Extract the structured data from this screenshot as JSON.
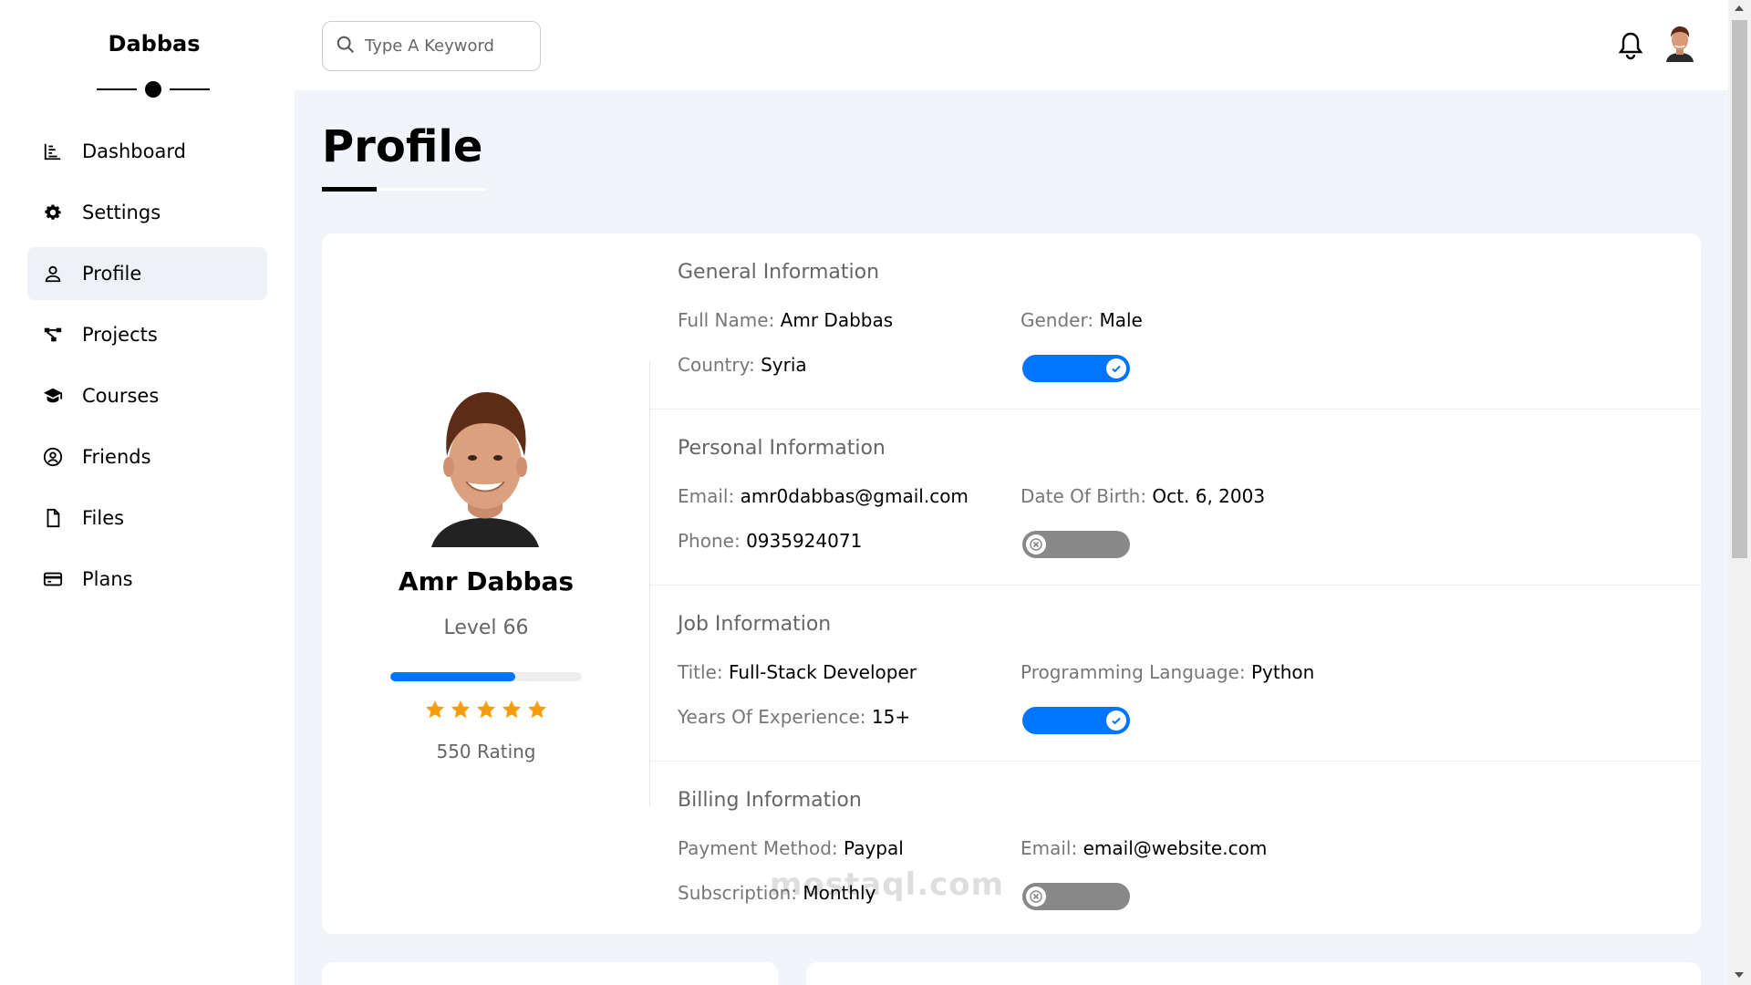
{
  "sidebar": {
    "brand": "Dabbas",
    "items": [
      {
        "label": "Dashboard",
        "icon": "chart-icon",
        "active": false
      },
      {
        "label": "Settings",
        "icon": "gear-icon",
        "active": false
      },
      {
        "label": "Profile",
        "icon": "user-icon",
        "active": true
      },
      {
        "label": "Projects",
        "icon": "diagram-icon",
        "active": false
      },
      {
        "label": "Courses",
        "icon": "graduation-cap-icon",
        "active": false
      },
      {
        "label": "Friends",
        "icon": "user-circle-icon",
        "active": false
      },
      {
        "label": "Files",
        "icon": "file-icon",
        "active": false
      },
      {
        "label": "Plans",
        "icon": "credit-card-icon",
        "active": false
      }
    ]
  },
  "header": {
    "search_placeholder": "Type A Keyword"
  },
  "page": {
    "title": "Profile"
  },
  "profile": {
    "name": "Amr Dabbas",
    "level": "Level 66",
    "progress_percent": 65,
    "stars": 5,
    "rating": "550 Rating"
  },
  "sections": [
    {
      "title": "General Information",
      "fields": [
        {
          "label": "Full Name:",
          "value": "Amr Dabbas"
        },
        {
          "label": "Country:",
          "value": "Syria"
        },
        {
          "label": "Gender:",
          "value": "Male"
        }
      ],
      "toggle_on": true
    },
    {
      "title": "Personal Information",
      "fields": [
        {
          "label": "Email:",
          "value": "amr0dabbas@gmail.com"
        },
        {
          "label": "Phone:",
          "value": "0935924071"
        },
        {
          "label": "Date Of Birth:",
          "value": "Oct. 6, 2003"
        }
      ],
      "toggle_on": false
    },
    {
      "title": "Job Information",
      "fields": [
        {
          "label": "Title:",
          "value": "Full-Stack Developer"
        },
        {
          "label": "Years Of Experience:",
          "value": "15+"
        },
        {
          "label": "Programming Language:",
          "value": "Python"
        }
      ],
      "toggle_on": true
    },
    {
      "title": "Billing Information",
      "fields": [
        {
          "label": "Payment Method:",
          "value": "Paypal"
        },
        {
          "label": "Subscription:",
          "value": "Monthly"
        },
        {
          "label": "Email:",
          "value": "email@website.com"
        }
      ],
      "toggle_on": false
    }
  ],
  "watermark": "mostaql.com",
  "colors": {
    "accent": "#0075ff",
    "star": "#f59e0b",
    "toggle_off": "#888888"
  }
}
